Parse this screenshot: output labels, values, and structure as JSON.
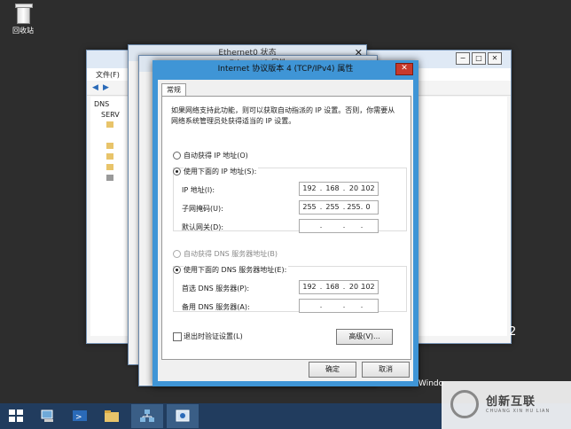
{
  "desktop": {
    "recycle_label": "回收站"
  },
  "dns_window": {
    "menu_file": "文件(F)",
    "tree_root": "DNS",
    "tree_server": "SERV"
  },
  "eth_windows": {
    "title1": "Ethernet0 状态",
    "title2": "Ethernet0 属性"
  },
  "dialog": {
    "title": "Internet 协议版本 4 (TCP/IPv4) 属性",
    "close_glyph": "✕",
    "tab_general": "常规",
    "description": "如果网络支持此功能，则可以获取自动指派的 IP 设置。否则，你需要从网络系统管理员处获得适当的 IP 设置。",
    "auto_ip": "自动获得 IP 地址(O)",
    "manual_ip": "使用下面的 IP 地址(S):",
    "ip_label": "IP 地址(I):",
    "ip": [
      "192",
      "168",
      "20",
      "102"
    ],
    "mask_label": "子网掩码(U):",
    "mask": [
      "255",
      "255",
      "255",
      "0"
    ],
    "gateway_label": "默认网关(D):",
    "gateway": [
      "",
      "",
      "",
      ""
    ],
    "auto_dns": "自动获得 DNS 服务器地址(B)",
    "manual_dns": "使用下面的 DNS 服务器地址(E):",
    "pref_dns_label": "首选 DNS 服务器(P):",
    "pref_dns": [
      "192",
      "168",
      "20",
      "102"
    ],
    "alt_dns_label": "备用 DNS 服务器(A):",
    "alt_dns": [
      "",
      "",
      "",
      ""
    ],
    "validate_label": "退出时验证设置(L)",
    "advanced_button": "高级(V)...",
    "ok_button": "确定",
    "cancel_button": "取消"
  },
  "desktop_text": {
    "windows": "Windo",
    "version": "2"
  },
  "watermark": {
    "cn": "创新互联",
    "en": "CHUANG XIN HU LIAN"
  },
  "colors": {
    "dialog_frame": "#3f95d6",
    "taskbar": "#213c5e",
    "close_red": "#c7392b"
  }
}
